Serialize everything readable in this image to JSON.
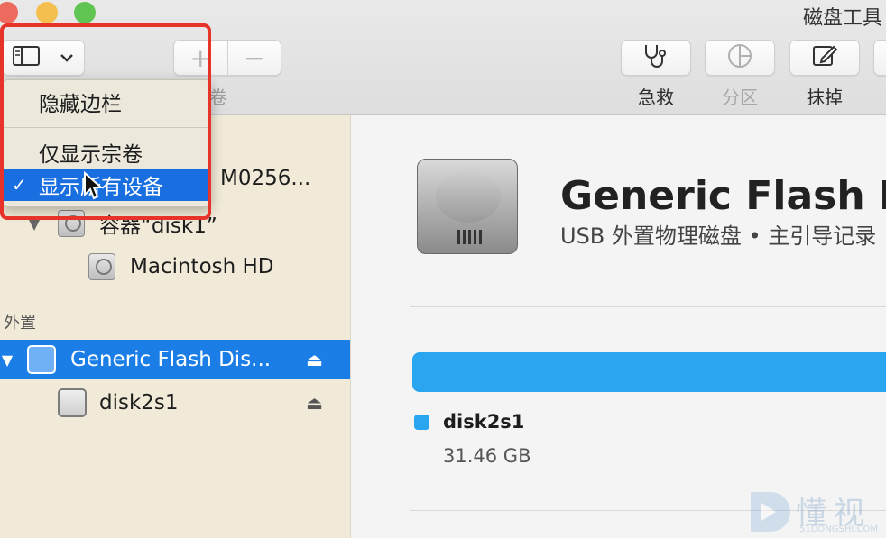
{
  "window": {
    "title": "磁盘工具"
  },
  "toolbar": {
    "add_symbol": "+",
    "remove_symbol": "−",
    "volume_label_fragment": "卷",
    "rescue_label": "急救",
    "partition_label": "分区",
    "erase_label": "抹掉"
  },
  "menu": {
    "items": [
      {
        "label": "隐藏边栏",
        "checked": false
      },
      {
        "label": "仅显示宗卷",
        "checked": false
      },
      {
        "label": "显示所有设备",
        "checked": true
      }
    ],
    "check_mark": "✓"
  },
  "sidebar": {
    "internal_fragment": "M0256...",
    "container_label": "容器“disk1”",
    "mac_label": "Macintosh HD",
    "external_section": "外置",
    "flash_label": "Generic Flash Dis...",
    "disk2s1_label": "disk2s1",
    "eject_symbol": "⏏"
  },
  "main": {
    "disk_title": "Generic Flash Di",
    "disk_subtitle": "USB 外置物理磁盘 • 主引导记录",
    "legend_name": "disk2s1",
    "legend_size": "31.46 GB"
  },
  "watermark": {
    "text": "懂视",
    "sub": "51DONGSHI.COM"
  },
  "colors": {
    "accent": "#1b7ee6",
    "usage_bar": "#2aa6f1",
    "highlight_box": "#e8332a"
  }
}
